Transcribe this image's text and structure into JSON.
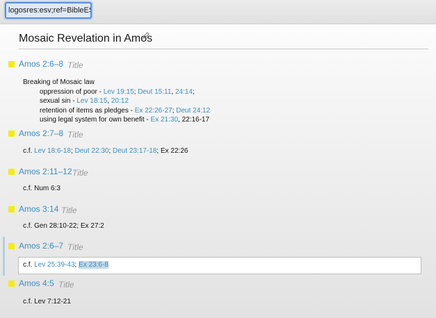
{
  "toolbar": {
    "url_value": "logosres:esv;ref=BibleESV"
  },
  "page": {
    "title": "Mosaic Revelation in Amos",
    "title_placeholder": "Title"
  },
  "notes": [
    {
      "ref": "Amos 2:6–8",
      "lines": [
        {
          "indent": 0,
          "parts": [
            {
              "t": "Breaking of Mosaic law"
            }
          ]
        },
        {
          "indent": 1,
          "parts": [
            {
              "t": "oppression of poor - "
            },
            {
              "t": "Lev 19:15",
              "link": true
            },
            {
              "t": "; "
            },
            {
              "t": "Deut 15:11",
              "link": true
            },
            {
              "t": ", "
            },
            {
              "t": "24:14",
              "link": true
            },
            {
              "t": ";"
            }
          ]
        },
        {
          "indent": 1,
          "parts": [
            {
              "t": "sexual sin - "
            },
            {
              "t": "Lev 18:15",
              "link": true
            },
            {
              "t": ", "
            },
            {
              "t": "20:12",
              "link": true
            }
          ]
        },
        {
          "indent": 1,
          "parts": [
            {
              "t": "retention of items as pledges - "
            },
            {
              "t": "Ex 22:26-27",
              "link": true
            },
            {
              "t": "; "
            },
            {
              "t": "Deut 24:12",
              "link": true
            }
          ]
        },
        {
          "indent": 1,
          "parts": [
            {
              "t": "using legal system for own benefit - "
            },
            {
              "t": "Ex 21:30",
              "link": true
            },
            {
              "t": ", 22:16-17"
            }
          ]
        }
      ]
    },
    {
      "ref": "Amos 2:7–8",
      "lines": [
        {
          "indent": 0,
          "parts": [
            {
              "t": "c.f. "
            },
            {
              "t": "Lev 18:6-18",
              "link": true
            },
            {
              "t": "; "
            },
            {
              "t": "Deut 22:30",
              "link": true
            },
            {
              "t": "; "
            },
            {
              "t": "Deut 23:17-18",
              "link": true
            },
            {
              "t": "; Ex 22:26"
            }
          ]
        }
      ]
    },
    {
      "ref": "Amos 2:11–12",
      "lines": [
        {
          "indent": 0,
          "parts": [
            {
              "t": "c.f. Num 6:3"
            }
          ]
        }
      ]
    },
    {
      "ref": "Amos 3:14",
      "lines": [
        {
          "indent": 0,
          "parts": [
            {
              "t": "c.f. Gen 28:10-22; Ex 27:2"
            }
          ]
        }
      ]
    },
    {
      "ref": "Amos 2:6–7",
      "active": true,
      "lines": [
        {
          "indent": 0,
          "parts": [
            {
              "t": "c.f. "
            },
            {
              "t": "Lev 25:39-43",
              "link": true
            },
            {
              "t": "; "
            },
            {
              "t": "Ex 23:6-8",
              "link": true,
              "selected": true
            }
          ]
        }
      ]
    },
    {
      "ref": "Amos 4:5",
      "lines": [
        {
          "indent": 0,
          "parts": [
            {
              "t": "c.f. Lev 7:12-21"
            }
          ]
        }
      ]
    }
  ],
  "colors": {
    "marker": "#f3ec12",
    "link": "#3b8ec1",
    "focus": "#5b8fd6"
  },
  "icons": {
    "edit_title": "pencil-icon"
  }
}
